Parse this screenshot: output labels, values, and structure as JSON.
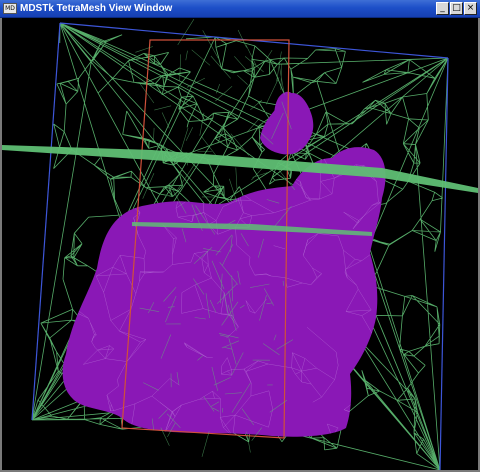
{
  "window": {
    "title": "MDSTk TetraMesh View Window",
    "icon_label": "MD",
    "buttons": {
      "minimize": "_",
      "maximize": "□",
      "close": "×"
    }
  },
  "viewport": {
    "background_color": "#000000",
    "mesh_color": "#5fbf74",
    "object_color": "#8a18b6",
    "bounding_box_color": "#3d56d9",
    "cut_plane_color": "#d0503a"
  }
}
